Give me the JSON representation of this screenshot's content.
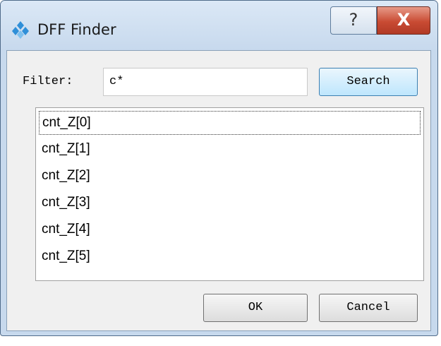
{
  "window": {
    "title": "DFF Finder",
    "help_glyph": "?",
    "close_glyph": "X"
  },
  "filter": {
    "label": "Filter:",
    "value": "c*",
    "search_label": "Search"
  },
  "results": {
    "items": [
      "cnt_Z[0]",
      "cnt_Z[1]",
      "cnt_Z[2]",
      "cnt_Z[3]",
      "cnt_Z[4]",
      "cnt_Z[5]"
    ],
    "focused_index": 0
  },
  "footer": {
    "ok_label": "OK",
    "cancel_label": "Cancel"
  },
  "icons": {
    "app": "app-logo-icon",
    "help": "help-icon",
    "close": "close-icon"
  },
  "colors": {
    "frame": "#c7d9ed",
    "close_button": "#c94b33",
    "logo": "#2f8fd8"
  }
}
